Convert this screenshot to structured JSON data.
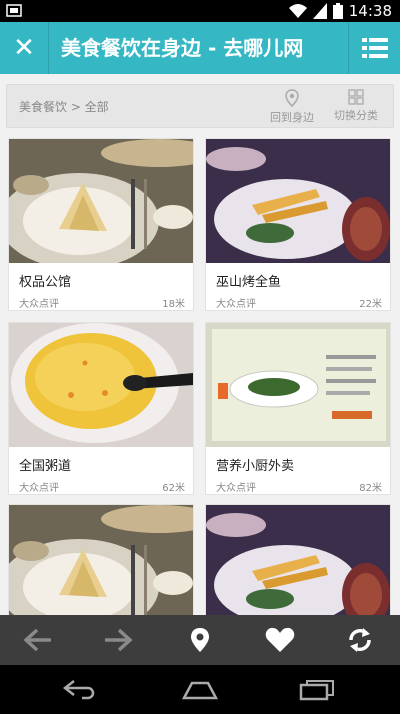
{
  "status_bar": {
    "time": "14:38"
  },
  "title_bar": {
    "title": "美食餐饮在身边 - 去哪儿网"
  },
  "filter_bar": {
    "breadcrumb": "美食餐饮 > 全部",
    "back_nearby_label": "回到身边",
    "switch_category_label": "切换分类"
  },
  "listings": [
    {
      "name": "权品公馆",
      "source": "大众点评",
      "distance": "18米"
    },
    {
      "name": "巫山烤全鱼",
      "source": "大众点评",
      "distance": "22米"
    },
    {
      "name": "全国粥道",
      "source": "大众点评",
      "distance": "62米"
    },
    {
      "name": "营养小厨外卖",
      "source": "大众点评",
      "distance": "82米"
    }
  ],
  "colors": {
    "accent": "#35b8c4",
    "bottom_nav": "#3d3d3d"
  }
}
